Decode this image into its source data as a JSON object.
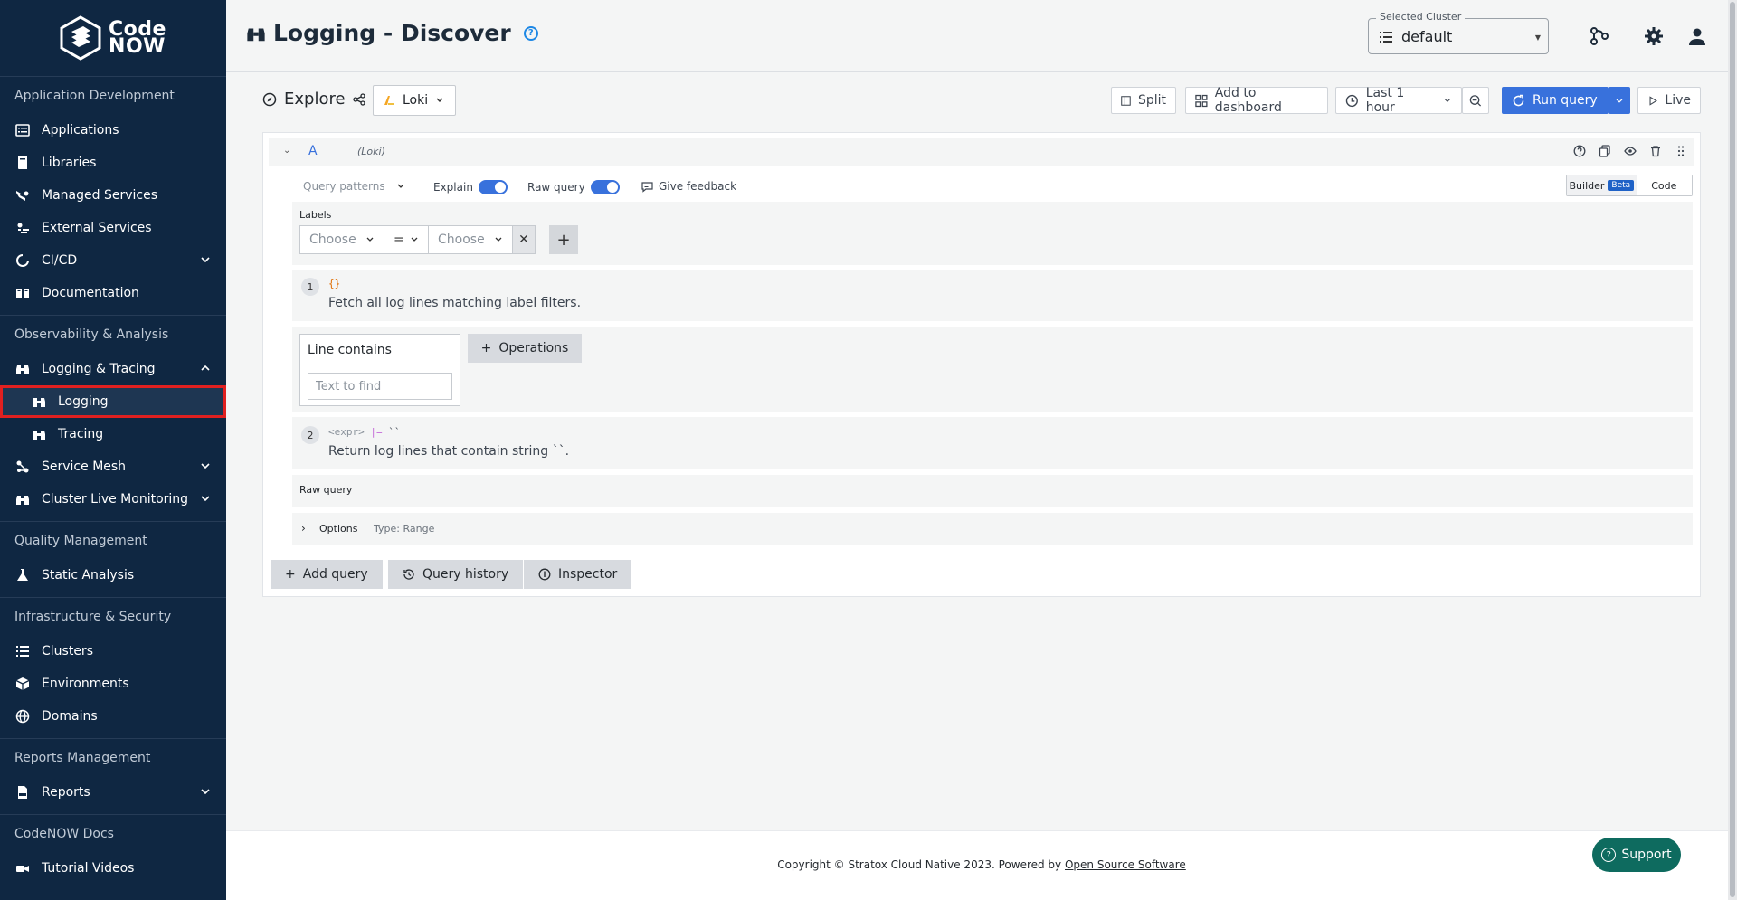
{
  "brand": {
    "name_line1": "Code",
    "name_line2": "NOW"
  },
  "sidebar": {
    "sections": [
      {
        "title": "Application Development",
        "items": [
          {
            "label": "Applications",
            "icon": "applications-icon"
          },
          {
            "label": "Libraries",
            "icon": "book-icon"
          },
          {
            "label": "Managed Services",
            "icon": "managed-services-icon"
          },
          {
            "label": "External Services",
            "icon": "external-services-icon"
          },
          {
            "label": "CI/CD",
            "icon": "cicd-icon",
            "expandable": true
          },
          {
            "label": "Documentation",
            "icon": "documentation-icon"
          }
        ]
      },
      {
        "title": "Observability & Analysis",
        "items": [
          {
            "label": "Logging & Tracing",
            "icon": "binoculars-icon",
            "expanded": true
          },
          {
            "label": "Logging",
            "icon": "binoculars-icon",
            "sub": true,
            "active": true
          },
          {
            "label": "Tracing",
            "icon": "binoculars-icon",
            "sub": true
          },
          {
            "label": "Service Mesh",
            "icon": "service-mesh-icon",
            "expandable": true
          },
          {
            "label": "Cluster Live Monitoring",
            "icon": "binoculars-icon",
            "expandable": true
          }
        ]
      },
      {
        "title": "Quality Management",
        "items": [
          {
            "label": "Static Analysis",
            "icon": "flask-icon"
          }
        ]
      },
      {
        "title": "Infrastructure & Security",
        "items": [
          {
            "label": "Clusters",
            "icon": "list-icon"
          },
          {
            "label": "Environments",
            "icon": "cube-icon"
          },
          {
            "label": "Domains",
            "icon": "globe-icon"
          }
        ]
      },
      {
        "title": "Reports Management",
        "items": [
          {
            "label": "Reports",
            "icon": "csv-icon",
            "expandable": true
          }
        ]
      },
      {
        "title": "CodeNOW Docs",
        "items": [
          {
            "label": "Tutorial Videos",
            "icon": "video-icon"
          }
        ]
      }
    ]
  },
  "header": {
    "title": "Logging - Discover",
    "cluster_label": "Selected Cluster",
    "cluster_value": "default"
  },
  "explore": {
    "title": "Explore",
    "datasource": "Loki",
    "split_label": "Split",
    "add_dashboard_label": "Add to dashboard",
    "time_range": "Last 1 hour",
    "run_query_label": "Run query",
    "live_label": "Live"
  },
  "query": {
    "letter": "A",
    "datasource": "(Loki)",
    "query_patterns": "Query patterns",
    "explain": "Explain",
    "raw_query_toggle": "Raw query",
    "give_feedback": "Give feedback",
    "builder": "Builder",
    "beta": "Beta",
    "code": "Code",
    "labels_title": "Labels",
    "label_choose": "Choose",
    "operator": "=",
    "value_choose": "Choose",
    "step1_code": "{}",
    "step1_desc": "Fetch all log lines matching label filters.",
    "line_contains": "Line contains",
    "text_placeholder": "Text to find",
    "operations": "Operations",
    "step2_code_expr": "<expr>",
    "step2_code_op": "|=",
    "step2_code_str": "``",
    "step2_desc": "Return log lines that contain string ``.",
    "raw_query_title": "Raw query",
    "options": "Options",
    "options_type": "Type: Range"
  },
  "actions": {
    "add_query": "Add query",
    "query_history": "Query history",
    "inspector": "Inspector"
  },
  "footer": {
    "copyright": "Copyright © Stratox Cloud Native 2023. Powered by",
    "link": "Open Source Software",
    "support": "Support"
  }
}
